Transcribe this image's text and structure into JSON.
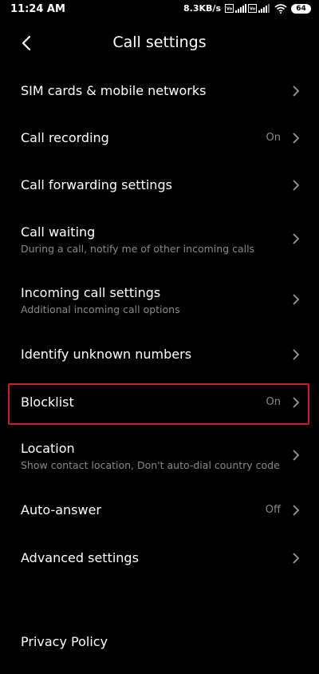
{
  "status_bar": {
    "time": "11:24 AM",
    "net_speed": "8.3KB/s",
    "battery": "64",
    "icons": [
      "volte-icon",
      "signal-icon",
      "volte-icon",
      "signal-icon",
      "wifi-icon",
      "battery-icon"
    ]
  },
  "header": {
    "back_icon": "back-arrow-icon",
    "title": "Call settings"
  },
  "items": [
    {
      "title": "SIM cards & mobile networks",
      "subtitle": "",
      "value": ""
    },
    {
      "title": "Call recording",
      "subtitle": "",
      "value": "On"
    },
    {
      "title": "Call forwarding settings",
      "subtitle": "",
      "value": ""
    },
    {
      "title": "Call waiting",
      "subtitle": "During a call, notify me of other incoming calls",
      "value": ""
    },
    {
      "title": "Incoming call settings",
      "subtitle": "Additional incoming call options",
      "value": ""
    },
    {
      "title": "Identify unknown numbers",
      "subtitle": "",
      "value": ""
    },
    {
      "title": "Blocklist",
      "subtitle": "",
      "value": "On"
    },
    {
      "title": "Location",
      "subtitle": "Show contact location, Don't auto-dial country code",
      "value": ""
    },
    {
      "title": "Auto-answer",
      "subtitle": "",
      "value": "Off"
    },
    {
      "title": "Advanced settings",
      "subtitle": "",
      "value": ""
    },
    {
      "title": "Privacy Policy",
      "subtitle": "",
      "value": ""
    }
  ],
  "colors": {
    "background": "#000000",
    "text": "#ffffff",
    "secondary_text": "#8a8a8a",
    "highlight_border": "#c4232f"
  }
}
